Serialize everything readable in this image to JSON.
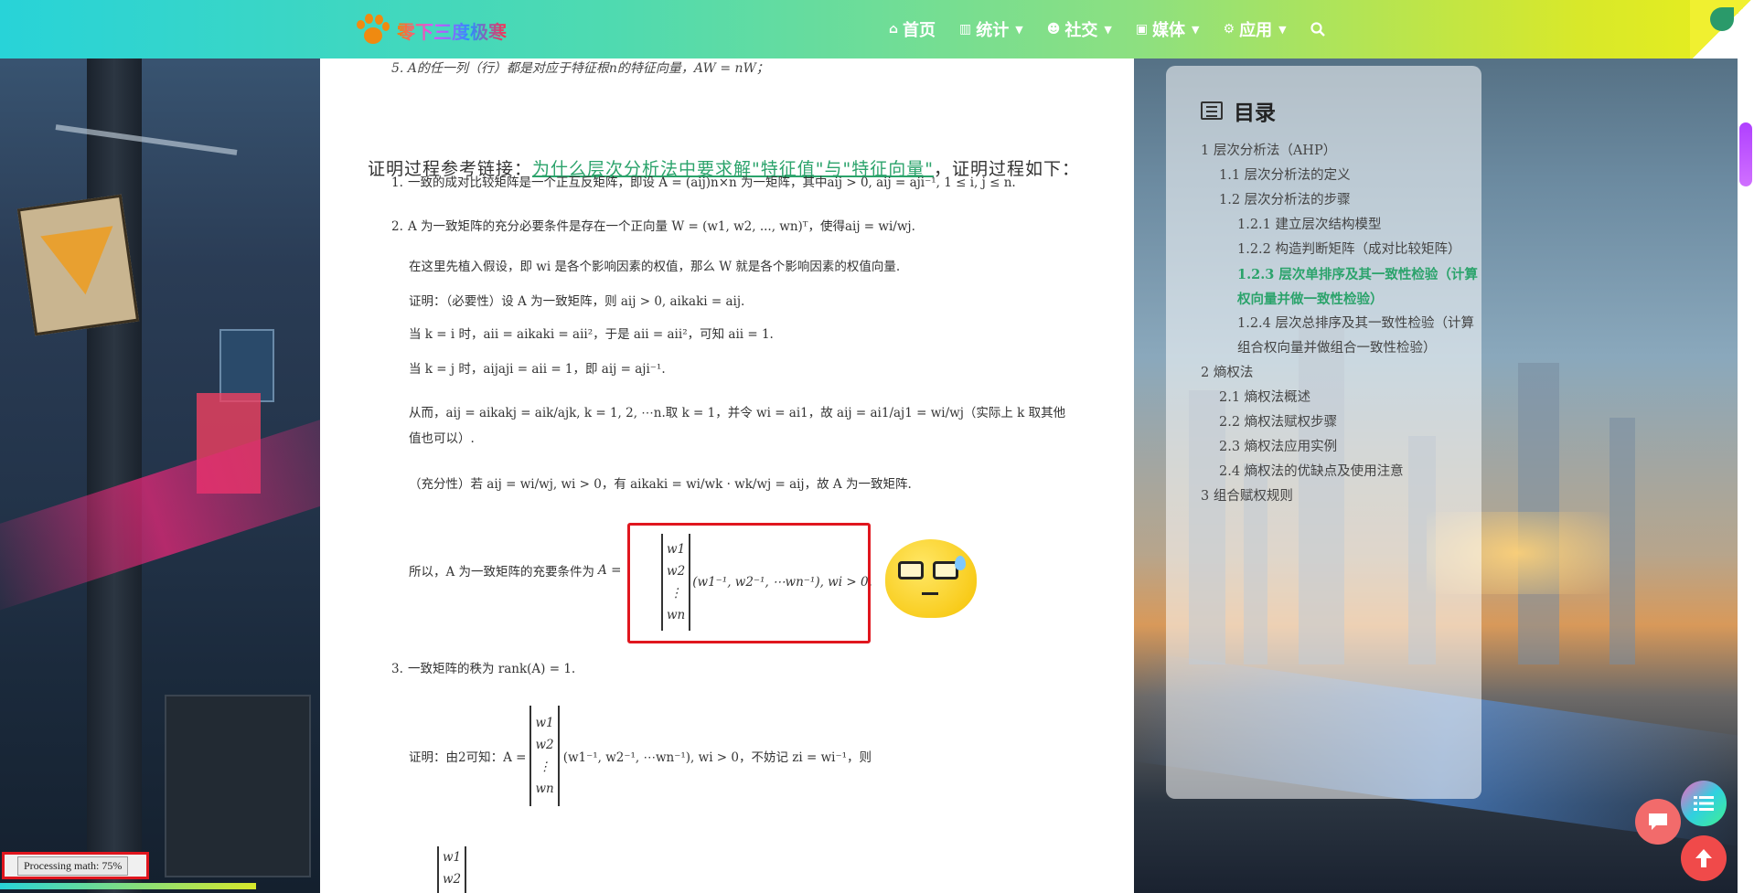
{
  "site": {
    "logo_text": "零下三度极寒"
  },
  "nav": {
    "items": [
      {
        "label": "首页",
        "icon": "home-icon",
        "has_dropdown": false
      },
      {
        "label": "统计",
        "icon": "chart-icon",
        "has_dropdown": true
      },
      {
        "label": "社交",
        "icon": "social-icon",
        "has_dropdown": true
      },
      {
        "label": "媒体",
        "icon": "media-icon",
        "has_dropdown": true
      },
      {
        "label": "应用",
        "icon": "gear-icon",
        "has_dropdown": true
      }
    ],
    "search_icon": "search-icon"
  },
  "article": {
    "cut_line": "5. A的任一列（行）都是对应于特征根n的特征向量，AW = nW；",
    "ref_prefix": "证明过程参考链接：",
    "ref_link": "为什么层次分析法中要求解\"特征值\"与\"特征向量\"",
    "ref_suffix": "，证明过程如下：",
    "item1_num": "1.",
    "item1": "一致的成对比较矩阵是一个正互反矩阵，即设 A = (aij)n×n 为一矩阵，其中aij > 0, aij = aji⁻¹, 1 ≤ i, j ≤ n.",
    "item2_num": "2.",
    "item2": "A 为一致矩阵的充分必要条件是存在一个正向量 W = (w1, w2, ..., wn)ᵀ，使得aij = wi/wj.",
    "p_assume": "在这里先植入假设，即 wi 是各个影响因素的权值，那么 W 就是各个影响因素的权值向量.",
    "p_proof1": "证明：（必要性）设 A 为一致矩阵，则 aij > 0,    aikaki = aij.",
    "p_k_i": "当 k = i 时，aii = aikaki = aii²，于是 aii = aii²，可知 aii = 1.",
    "p_k_j": "当 k = j 时，aijaji = aii = 1，即 aij = aji⁻¹.",
    "p_thus": "从而，aij = aikakj = aik/ajk, k = 1, 2, ⋯n.取 k = 1，并令 wi = ai1，故 aij = ai1/aj1 = wi/wj（实际上 k 取其他值也可以）.",
    "p_suff": "（充分性）若 aij = wi/wj, wi > 0，有 aikaki = wi/wk · wk/wj = aij，故 A 为一致矩阵.",
    "p_conclusion": "所以，A 为一致矩阵的充要条件为",
    "eq_lhs": "A =",
    "eq_vec": [
      "w1",
      "w2",
      "⋮",
      "wn"
    ],
    "eq_rhs": "(w1⁻¹, w2⁻¹, ⋯wn⁻¹), wi > 0.",
    "item3_num": "3.",
    "item3": "一致矩阵的秩为 rank(A) = 1.",
    "p_proof3_a": "证明：由2可知：A =",
    "p_proof3_vec": [
      "w1",
      "w2",
      "⋮",
      "wn"
    ],
    "p_proof3_b": "(w1⁻¹, w2⁻¹, ⋯wn⁻¹), wi > 0，不妨记 zi = wi⁻¹，则",
    "p_proof3_vec2": [
      "w1",
      "w2"
    ]
  },
  "toc": {
    "title": "目录",
    "items": [
      {
        "label": "1 层次分析法（AHP）",
        "level": 1,
        "active": false
      },
      {
        "label": "1.1 层次分析法的定义",
        "level": 2,
        "active": false
      },
      {
        "label": "1.2 层次分析法的步骤",
        "level": 2,
        "active": false
      },
      {
        "label": "1.2.1 建立层次结构模型",
        "level": 3,
        "active": false
      },
      {
        "label": "1.2.2 构造判断矩阵（成对比较矩阵）",
        "level": 3,
        "active": false
      },
      {
        "label": "1.2.3 层次单排序及其一致性检验（计算权向量并做一致性检验）",
        "level": 3,
        "active": true
      },
      {
        "label": "1.2.4 层次总排序及其一致性检验（计算组合权向量并做组合一致性检验）",
        "level": 3,
        "active": false
      },
      {
        "label": "2 熵权法",
        "level": 1,
        "active": false
      },
      {
        "label": "2.1 熵权法概述",
        "level": 2,
        "active": false
      },
      {
        "label": "2.2 熵权法赋权步骤",
        "level": 2,
        "active": false
      },
      {
        "label": "2.3 熵权法应用实例",
        "level": 2,
        "active": false
      },
      {
        "label": "2.4 熵权法的优缺点及使用注意",
        "level": 2,
        "active": false
      },
      {
        "label": "3 组合赋权规则",
        "level": 1,
        "active": false
      }
    ]
  },
  "status": {
    "mathjax": "Processing math: 75%"
  },
  "colors": {
    "accent": "#2ba36b",
    "highlight": "#e0161e"
  }
}
